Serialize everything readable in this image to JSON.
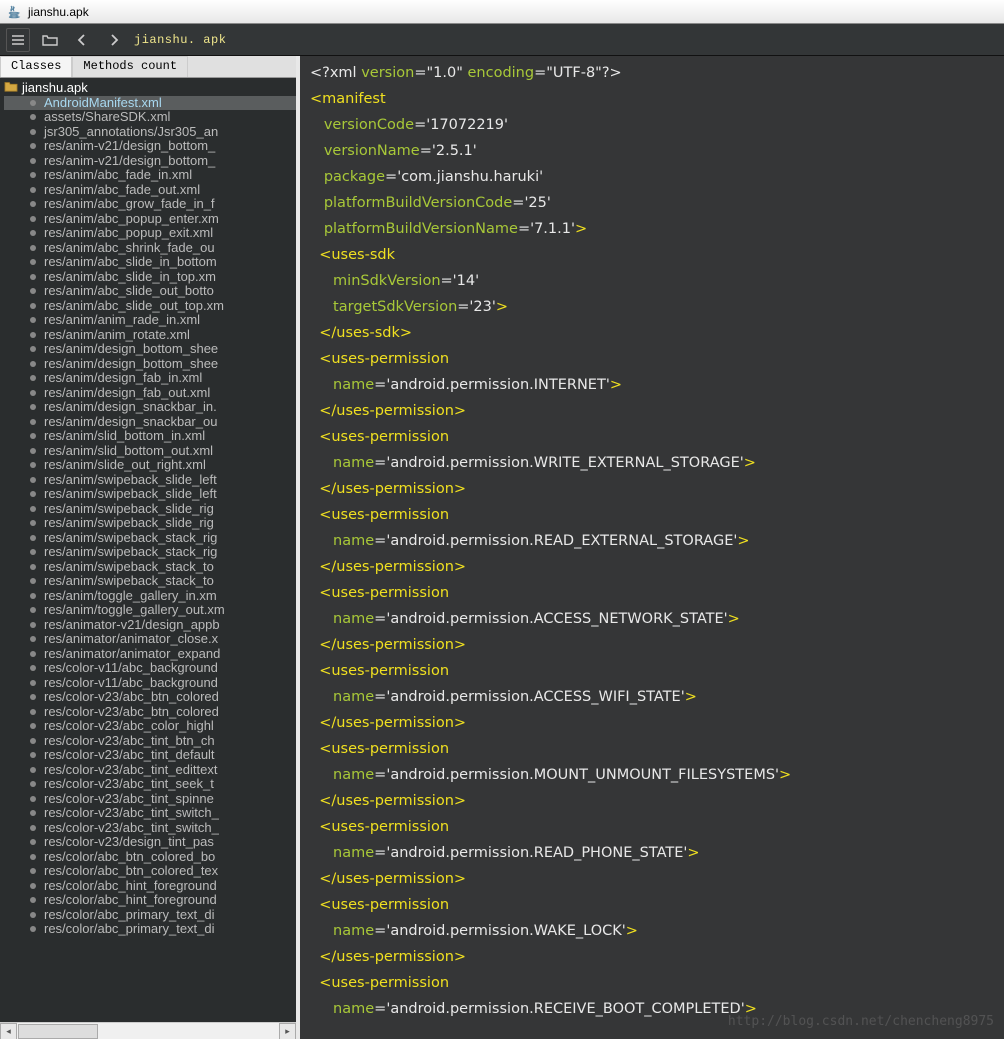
{
  "window": {
    "title": "jianshu.apk"
  },
  "toolbar": {
    "path": "jianshu. apk"
  },
  "tabs": [
    {
      "label": "Classes",
      "active": true
    },
    {
      "label": "Methods count",
      "active": false
    }
  ],
  "tree": {
    "root": "jianshu.apk",
    "selected": "AndroidManifest.xml",
    "items": [
      "AndroidManifest.xml",
      "assets/ShareSDK.xml",
      "jsr305_annotations/Jsr305_an",
      "res/anim-v21/design_bottom_",
      "res/anim-v21/design_bottom_",
      "res/anim/abc_fade_in.xml",
      "res/anim/abc_fade_out.xml",
      "res/anim/abc_grow_fade_in_f",
      "res/anim/abc_popup_enter.xm",
      "res/anim/abc_popup_exit.xml",
      "res/anim/abc_shrink_fade_ou",
      "res/anim/abc_slide_in_bottom",
      "res/anim/abc_slide_in_top.xm",
      "res/anim/abc_slide_out_botto",
      "res/anim/abc_slide_out_top.xm",
      "res/anim/anim_rade_in.xml",
      "res/anim/anim_rotate.xml",
      "res/anim/design_bottom_shee",
      "res/anim/design_bottom_shee",
      "res/anim/design_fab_in.xml",
      "res/anim/design_fab_out.xml",
      "res/anim/design_snackbar_in.",
      "res/anim/design_snackbar_ou",
      "res/anim/slid_bottom_in.xml",
      "res/anim/slid_bottom_out.xml",
      "res/anim/slide_out_right.xml",
      "res/anim/swipeback_slide_left",
      "res/anim/swipeback_slide_left",
      "res/anim/swipeback_slide_rig",
      "res/anim/swipeback_slide_rig",
      "res/anim/swipeback_stack_rig",
      "res/anim/swipeback_stack_rig",
      "res/anim/swipeback_stack_to",
      "res/anim/swipeback_stack_to",
      "res/anim/toggle_gallery_in.xm",
      "res/anim/toggle_gallery_out.xm",
      "res/animator-v21/design_appb",
      "res/animator/animator_close.x",
      "res/animator/animator_expand",
      "res/color-v11/abc_background",
      "res/color-v11/abc_background",
      "res/color-v23/abc_btn_colored",
      "res/color-v23/abc_btn_colored",
      "res/color-v23/abc_color_highl",
      "res/color-v23/abc_tint_btn_ch",
      "res/color-v23/abc_tint_default",
      "res/color-v23/abc_tint_edittext",
      "res/color-v23/abc_tint_seek_t",
      "res/color-v23/abc_tint_spinne",
      "res/color-v23/abc_tint_switch_",
      "res/color-v23/abc_tint_switch_",
      "res/color-v23/design_tint_pas",
      "res/color/abc_btn_colored_bo",
      "res/color/abc_btn_colored_tex",
      "res/color/abc_hint_foreground",
      "res/color/abc_hint_foreground",
      "res/color/abc_primary_text_di",
      "res/color/abc_primary_text_di"
    ]
  },
  "code": [
    [
      [
        "decl",
        "<?xml "
      ],
      [
        "attr",
        "version"
      ],
      [
        "punct",
        "="
      ],
      [
        "val",
        "\"1.0\" "
      ],
      [
        "attr",
        "encoding"
      ],
      [
        "punct",
        "="
      ],
      [
        "val",
        "\"UTF-8\""
      ],
      [
        "decl",
        "?>"
      ]
    ],
    [
      [
        "tag",
        "<manifest"
      ]
    ],
    [
      [
        "pad",
        "   "
      ],
      [
        "attr",
        "versionCode"
      ],
      [
        "punct",
        "="
      ],
      [
        "val",
        "'17072219'"
      ]
    ],
    [
      [
        "pad",
        "   "
      ],
      [
        "attr",
        "versionName"
      ],
      [
        "punct",
        "="
      ],
      [
        "val",
        "'2.5.1'"
      ]
    ],
    [
      [
        "pad",
        "   "
      ],
      [
        "attr",
        "package"
      ],
      [
        "punct",
        "="
      ],
      [
        "val",
        "'com.jianshu.haruki'"
      ]
    ],
    [
      [
        "pad",
        "   "
      ],
      [
        "attr",
        "platformBuildVersionCode"
      ],
      [
        "punct",
        "="
      ],
      [
        "val",
        "'25'"
      ]
    ],
    [
      [
        "pad",
        "   "
      ],
      [
        "attr",
        "platformBuildVersionName"
      ],
      [
        "punct",
        "="
      ],
      [
        "val",
        "'7.1.1'"
      ],
      [
        "tag",
        ">"
      ]
    ],
    [
      [
        "pad",
        "  "
      ],
      [
        "tag",
        "<uses-sdk"
      ]
    ],
    [
      [
        "pad",
        "     "
      ],
      [
        "attr",
        "minSdkVersion"
      ],
      [
        "punct",
        "="
      ],
      [
        "val",
        "'14'"
      ]
    ],
    [
      [
        "pad",
        "     "
      ],
      [
        "attr",
        "targetSdkVersion"
      ],
      [
        "punct",
        "="
      ],
      [
        "val",
        "'23'"
      ],
      [
        "tag",
        ">"
      ]
    ],
    [
      [
        "pad",
        "  "
      ],
      [
        "tag",
        "</uses-sdk>"
      ]
    ],
    [
      [
        "pad",
        "  "
      ],
      [
        "tag",
        "<uses-permission"
      ]
    ],
    [
      [
        "pad",
        "     "
      ],
      [
        "attr",
        "name"
      ],
      [
        "punct",
        "="
      ],
      [
        "val",
        "'android.permission.INTERNET'"
      ],
      [
        "tag",
        ">"
      ]
    ],
    [
      [
        "pad",
        "  "
      ],
      [
        "tag",
        "</uses-permission>"
      ]
    ],
    [
      [
        "pad",
        "  "
      ],
      [
        "tag",
        "<uses-permission"
      ]
    ],
    [
      [
        "pad",
        "     "
      ],
      [
        "attr",
        "name"
      ],
      [
        "punct",
        "="
      ],
      [
        "val",
        "'android.permission.WRITE_EXTERNAL_STORAGE'"
      ],
      [
        "tag",
        ">"
      ]
    ],
    [
      [
        "pad",
        "  "
      ],
      [
        "tag",
        "</uses-permission>"
      ]
    ],
    [
      [
        "pad",
        "  "
      ],
      [
        "tag",
        "<uses-permission"
      ]
    ],
    [
      [
        "pad",
        "     "
      ],
      [
        "attr",
        "name"
      ],
      [
        "punct",
        "="
      ],
      [
        "val",
        "'android.permission.READ_EXTERNAL_STORAGE'"
      ],
      [
        "tag",
        ">"
      ]
    ],
    [
      [
        "pad",
        "  "
      ],
      [
        "tag",
        "</uses-permission>"
      ]
    ],
    [
      [
        "pad",
        "  "
      ],
      [
        "tag",
        "<uses-permission"
      ]
    ],
    [
      [
        "pad",
        "     "
      ],
      [
        "attr",
        "name"
      ],
      [
        "punct",
        "="
      ],
      [
        "val",
        "'android.permission.ACCESS_NETWORK_STATE'"
      ],
      [
        "tag",
        ">"
      ]
    ],
    [
      [
        "pad",
        "  "
      ],
      [
        "tag",
        "</uses-permission>"
      ]
    ],
    [
      [
        "pad",
        "  "
      ],
      [
        "tag",
        "<uses-permission"
      ]
    ],
    [
      [
        "pad",
        "     "
      ],
      [
        "attr",
        "name"
      ],
      [
        "punct",
        "="
      ],
      [
        "val",
        "'android.permission.ACCESS_WIFI_STATE'"
      ],
      [
        "tag",
        ">"
      ]
    ],
    [
      [
        "pad",
        "  "
      ],
      [
        "tag",
        "</uses-permission>"
      ]
    ],
    [
      [
        "pad",
        "  "
      ],
      [
        "tag",
        "<uses-permission"
      ]
    ],
    [
      [
        "pad",
        "     "
      ],
      [
        "attr",
        "name"
      ],
      [
        "punct",
        "="
      ],
      [
        "val",
        "'android.permission.MOUNT_UNMOUNT_FILESYSTEMS'"
      ],
      [
        "tag",
        ">"
      ]
    ],
    [
      [
        "pad",
        "  "
      ],
      [
        "tag",
        "</uses-permission>"
      ]
    ],
    [
      [
        "pad",
        "  "
      ],
      [
        "tag",
        "<uses-permission"
      ]
    ],
    [
      [
        "pad",
        "     "
      ],
      [
        "attr",
        "name"
      ],
      [
        "punct",
        "="
      ],
      [
        "val",
        "'android.permission.READ_PHONE_STATE'"
      ],
      [
        "tag",
        ">"
      ]
    ],
    [
      [
        "pad",
        "  "
      ],
      [
        "tag",
        "</uses-permission>"
      ]
    ],
    [
      [
        "pad",
        "  "
      ],
      [
        "tag",
        "<uses-permission"
      ]
    ],
    [
      [
        "pad",
        "     "
      ],
      [
        "attr",
        "name"
      ],
      [
        "punct",
        "="
      ],
      [
        "val",
        "'android.permission.WAKE_LOCK'"
      ],
      [
        "tag",
        ">"
      ]
    ],
    [
      [
        "pad",
        "  "
      ],
      [
        "tag",
        "</uses-permission>"
      ]
    ],
    [
      [
        "pad",
        "  "
      ],
      [
        "tag",
        "<uses-permission"
      ]
    ],
    [
      [
        "pad",
        "     "
      ],
      [
        "attr",
        "name"
      ],
      [
        "punct",
        "="
      ],
      [
        "val",
        "'android.permission.RECEIVE_BOOT_COMPLETED'"
      ],
      [
        "tag",
        ">"
      ]
    ]
  ],
  "watermark": "http://blog.csdn.net/chencheng8975"
}
